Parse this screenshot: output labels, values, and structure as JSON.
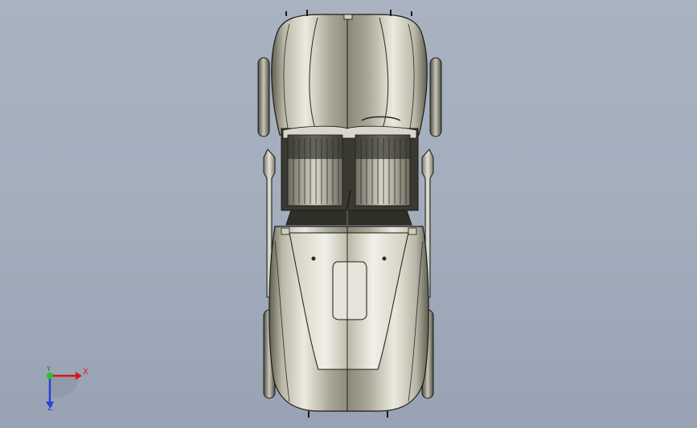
{
  "viewport": {
    "background_top": "#a9b2c1",
    "background_bottom": "#97a2b3"
  },
  "model": {
    "body_color": "#d4d2c0",
    "shadow_color": "#6e6c5d",
    "edge_color": "#1a1a16",
    "highlight_color": "#f4f3ea"
  },
  "triad": {
    "x_label": "X",
    "y_label": "Y",
    "z_label": "Z",
    "x_color": "#e0141a",
    "y_color": "#2bc22b",
    "z_color": "#2a3fd6"
  }
}
